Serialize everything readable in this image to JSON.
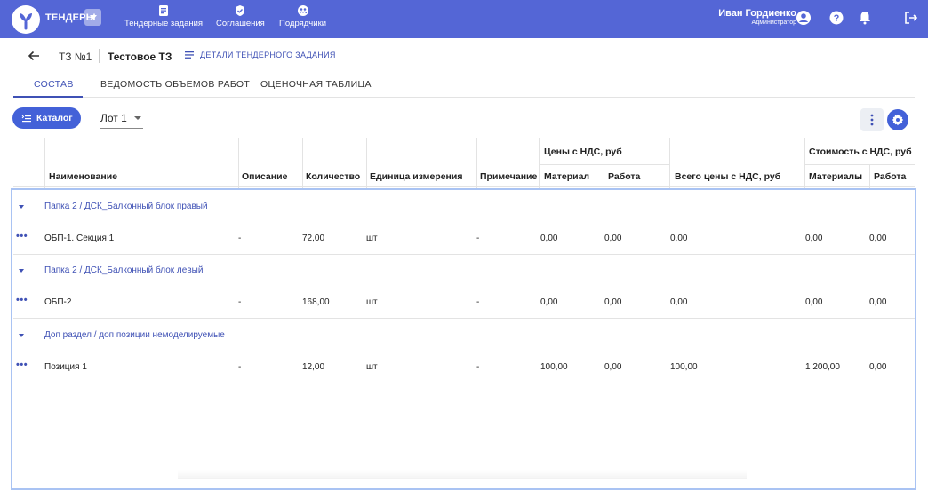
{
  "header": {
    "brand": "ТЕНДЕРЫ",
    "nav": [
      {
        "label": "Тендерные задания",
        "icon": "document-icon"
      },
      {
        "label": "Соглашения",
        "icon": "shield-check-icon"
      },
      {
        "label": "Подрядчики",
        "icon": "contractors-icon"
      }
    ],
    "user_name": "Иван Гордиенко",
    "user_role": "Администратор",
    "accent": "#5466d6"
  },
  "breadcrumb": {
    "tz_number": "ТЗ №1",
    "tz_name": "Тестовое ТЗ",
    "details_link": "ДЕТАЛИ ТЕНДЕРНОГО ЗАДАНИЯ"
  },
  "tabs": [
    {
      "label": "СОСТАВ",
      "active": true
    },
    {
      "label": "ВЕДОМОСТЬ ОБЪЕМОВ РАБОТ",
      "active": false
    },
    {
      "label": "ОЦЕНОЧНАЯ ТАБЛИЦА",
      "active": false
    }
  ],
  "toolbar": {
    "catalog_label": "Каталог",
    "lot_value": "Лот 1"
  },
  "table": {
    "headers": {
      "name": "Наименование",
      "description": "Описание",
      "quantity": "Количество",
      "unit": "Единица измерения",
      "note": "Примечание",
      "prices_group": "Цены с НДС, руб",
      "material": "Материал",
      "work": "Работа",
      "total_price": "Всего цены с НДС, руб",
      "cost_group": "Стоимость с НДС, руб",
      "materials": "Материалы",
      "work2": "Работа"
    },
    "groups": [
      {
        "title": "Папка 2 / ДСК_Балконный блок правый",
        "rows": [
          {
            "name": "ОБП-1. Секция 1",
            "description": "-",
            "quantity": "72,00",
            "unit": "шт",
            "note": "-",
            "material": "0,00",
            "work": "0,00",
            "total": "0,00",
            "cost_material": "0,00",
            "cost_work": "0,00"
          }
        ]
      },
      {
        "title": "Папка 2 / ДСК_Балконный блок левый",
        "rows": [
          {
            "name": "ОБП-2",
            "description": "-",
            "quantity": "168,00",
            "unit": "шт",
            "note": "-",
            "material": "0,00",
            "work": "0,00",
            "total": "0,00",
            "cost_material": "0,00",
            "cost_work": "0,00"
          }
        ]
      },
      {
        "title": "Доп раздел / доп позиции немоделируемые",
        "rows": [
          {
            "name": "Позиция 1",
            "description": "-",
            "quantity": "12,00",
            "unit": "шт",
            "note": "-",
            "material": "100,00",
            "work": "0,00",
            "total": "100,00",
            "cost_material": "1 200,00",
            "cost_work": "0,00"
          }
        ]
      }
    ]
  }
}
